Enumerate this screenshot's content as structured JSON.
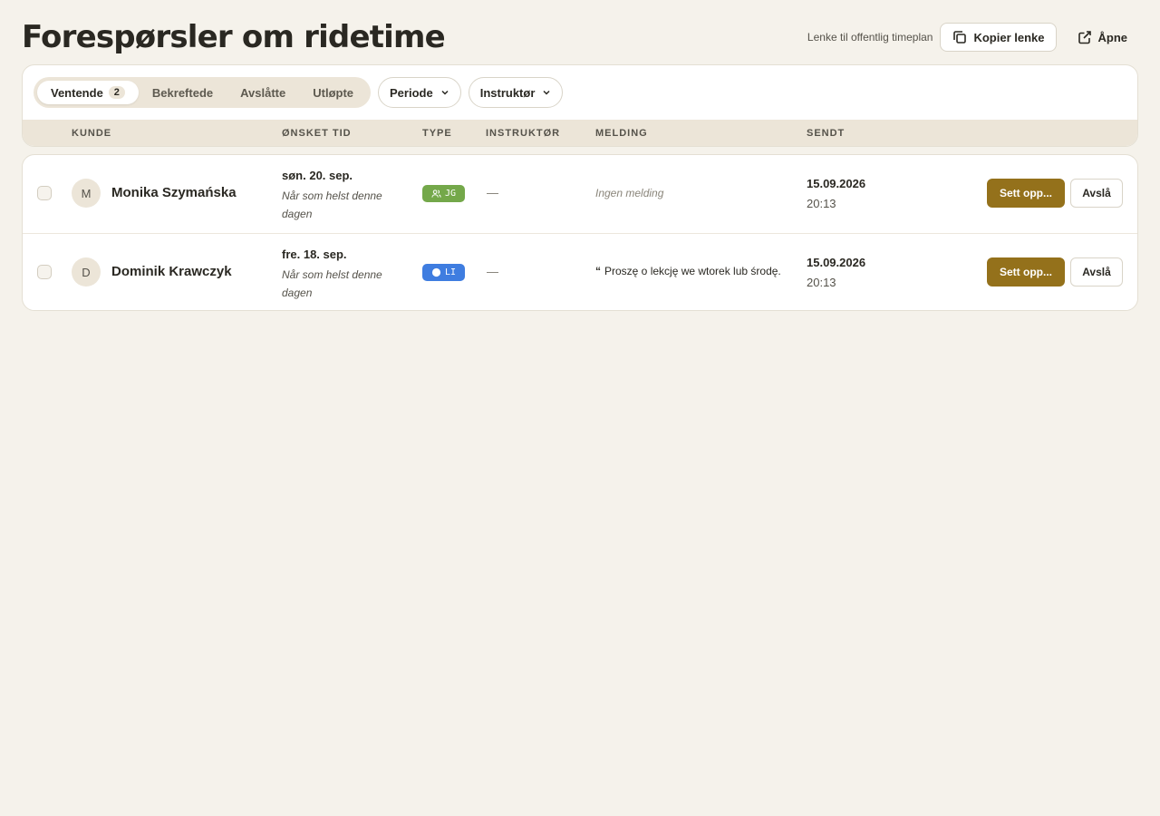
{
  "header": {
    "title": "Forespørsler om ridetime",
    "link_caption": "Lenke til offentlig timeplan",
    "copy_label": "Kopier lenke",
    "open_label": "Åpne"
  },
  "tabs": [
    {
      "label": "Ventende",
      "count": "2",
      "active": true
    },
    {
      "label": "Bekreftede"
    },
    {
      "label": "Avslåtte"
    },
    {
      "label": "Utløpte"
    }
  ],
  "filters": {
    "period_label": "Periode",
    "instructor_label": "Instruktør"
  },
  "columns": {
    "customer": "KUNDE",
    "wanted_time": "ØNSKET TID",
    "type": "TYPE",
    "instructor": "INSTRUKTØR",
    "message": "MELDING",
    "sent": "SENDT"
  },
  "rows": [
    {
      "initial": "M",
      "name": "Monika Szymańska",
      "date": "søn. 20. sep.",
      "date_sub": "Når som helst denne dagen",
      "type_code": "JG",
      "type_icon": "users-icon",
      "type_color": "#74a84a",
      "instructor": "—",
      "message": "Ingen melding",
      "message_quote": "",
      "sent_date": "15.09.2026",
      "sent_time": "20:13",
      "setup_label": "Sett opp...",
      "decline_label": "Avslå"
    },
    {
      "initial": "D",
      "name": "Dominik Krawczyk",
      "date": "fre. 18. sep.",
      "date_sub": "Når som helst denne dagen",
      "type_code": "LI",
      "type_icon": "user-icon",
      "type_color": "#3f7de0",
      "instructor": "—",
      "message": "Proszę o lekcję we wtorek lub środę.",
      "message_quote": "“",
      "sent_date": "15.09.2026",
      "sent_time": "20:13",
      "setup_label": "Sett opp...",
      "decline_label": "Avslå"
    }
  ],
  "colors": {
    "background": "#f5f2eb",
    "accent": "#94711b",
    "muted_bg": "#ece5d8"
  }
}
